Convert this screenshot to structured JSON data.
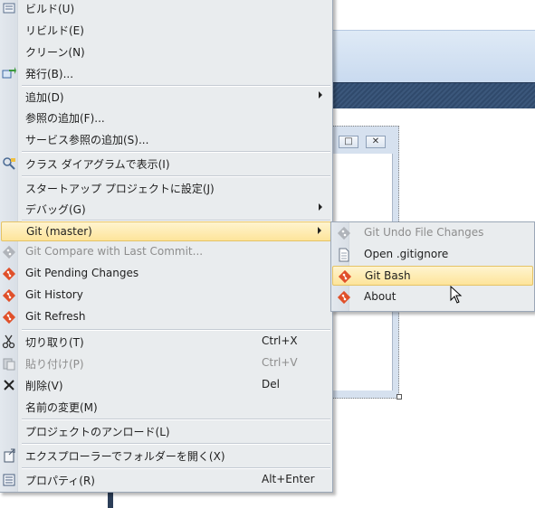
{
  "context_menu": {
    "items": [
      {
        "label": "ビルド(U)"
      },
      {
        "label": "リビルド(E)"
      },
      {
        "label": "クリーン(N)"
      },
      {
        "label": "発行(B)..."
      },
      {
        "label": "追加(D)"
      },
      {
        "label": "参照の追加(F)..."
      },
      {
        "label": "サービス参照の追加(S)..."
      },
      {
        "label": "クラス ダイアグラムで表示(I)"
      },
      {
        "label": "スタートアップ プロジェクトに設定(J)"
      },
      {
        "label": "デバッグ(G)"
      },
      {
        "label": "Git (master)"
      },
      {
        "label": "Git Compare with Last Commit..."
      },
      {
        "label": "Git Pending Changes"
      },
      {
        "label": "Git History"
      },
      {
        "label": "Git Refresh"
      },
      {
        "label": "切り取り(T)",
        "shortcut": "Ctrl+X"
      },
      {
        "label": "貼り付け(P)",
        "shortcut": "Ctrl+V"
      },
      {
        "label": "削除(V)",
        "shortcut": "Del"
      },
      {
        "label": "名前の変更(M)"
      },
      {
        "label": "プロジェクトのアンロード(L)"
      },
      {
        "label": "エクスプローラーでフォルダーを開く(X)"
      },
      {
        "label": "プロパティ(R)",
        "shortcut": "Alt+Enter"
      }
    ]
  },
  "git_submenu": {
    "items": [
      {
        "label": "Git Undo File Changes"
      },
      {
        "label": "Open .gitignore"
      },
      {
        "label": "Git Bash"
      },
      {
        "label": "About"
      }
    ]
  },
  "colors": {
    "git_icon": "#e0502a",
    "highlight": "#fde49a",
    "navy_bar": "#304a6c"
  }
}
